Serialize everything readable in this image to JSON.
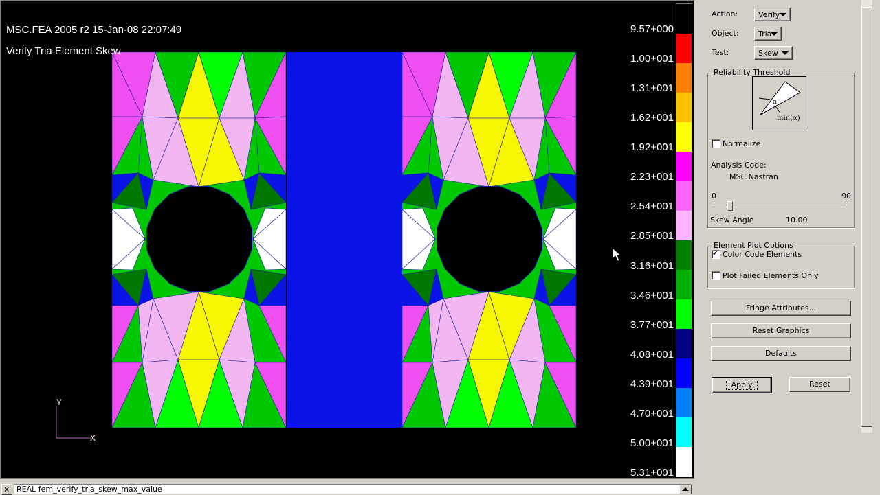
{
  "viewport": {
    "title_line1": "MSC.FEA 2005 r2 15-Jan-08 22:07:49",
    "title_line2": "Verify Tria Element Skew",
    "axis_x": "X",
    "axis_y": "Y"
  },
  "legend": {
    "labels": [
      "9.57+000",
      "1.00+001",
      "1.31+001",
      "1.62+001",
      "1.92+001",
      "2.23+001",
      "2.54+001",
      "2.85+001",
      "3.16+001",
      "3.46+001",
      "3.77+001",
      "4.08+001",
      "4.39+001",
      "4.70+001",
      "5.00+001",
      "5.31+001"
    ],
    "colors": [
      "#000000",
      "#ff0000",
      "#ff8000",
      "#ffc000",
      "#ffff00",
      "#ff00ff",
      "#ff66ff",
      "#ffb3ff",
      "#008000",
      "#00b000",
      "#00ff00",
      "#000080",
      "#0000ff",
      "#0080ff",
      "#00ffff",
      "#ffffff"
    ]
  },
  "mesh_colors": {
    "pink": "#ef4ff0",
    "light_pink": "#f2b6f2",
    "yellow": "#f7f700",
    "green": "#00c800",
    "bright_green": "#00ff00",
    "dark_green": "#007800",
    "blue": "#0a14e6",
    "white": "#ffffff",
    "panel_blue": "#0a14e6"
  },
  "panel": {
    "action_label": "Action:",
    "action_value": "Verify",
    "object_label": "Object:",
    "object_value": "Tria",
    "test_label": "Test:",
    "test_value": "Skew",
    "reliability_title": "Reliability Threshold",
    "diagram_alpha": "α",
    "diagram_min": "min(α)",
    "normalize_label": "Normalize",
    "normalize_checked": false,
    "analysis_code_label": "Analysis Code:",
    "analysis_code_value": "MSC.Nastran",
    "slider_min": "0",
    "slider_max": "90",
    "skew_angle_label": "Skew Angle",
    "skew_angle_value": "10.00",
    "element_plot_title": "Element Plot Options",
    "color_code_label": "Color Code Elements",
    "color_code_checked": true,
    "plot_failed_label": "Plot Failed Elements Only",
    "plot_failed_checked": false,
    "fringe_button": "Fringe Attributes...",
    "reset_graphics_button": "Reset Graphics",
    "defaults_button": "Defaults",
    "apply_button": "Apply",
    "reset_button": "Reset"
  },
  "status": {
    "text": "REAL fem_verify_tria_skew_max_value",
    "close": "x"
  }
}
